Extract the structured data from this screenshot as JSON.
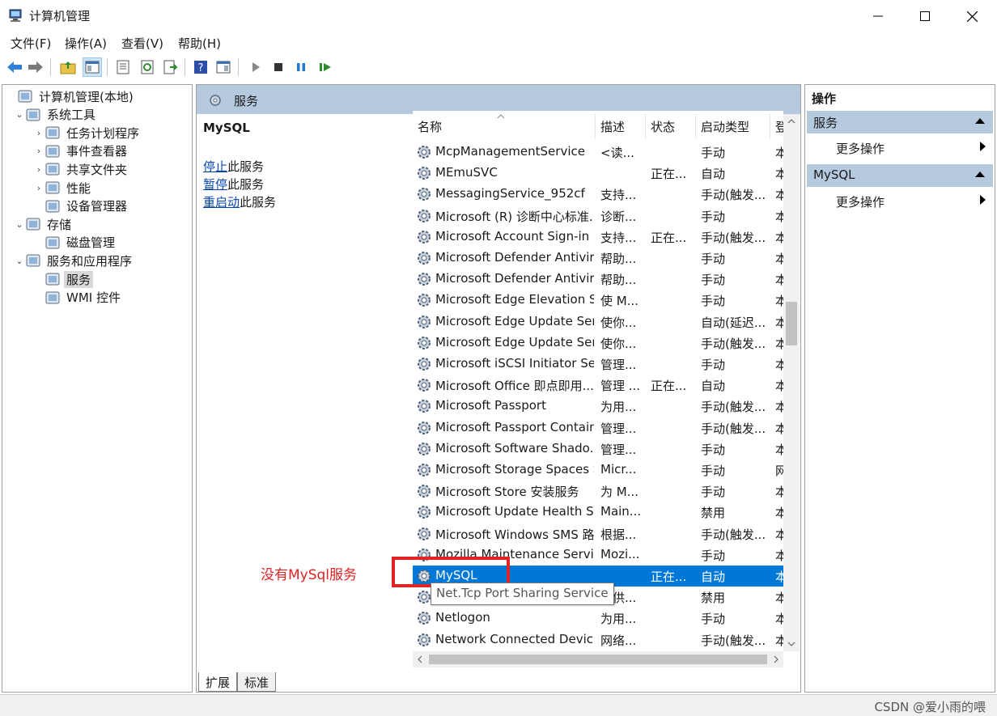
{
  "window": {
    "title": "计算机管理"
  },
  "menu": [
    "文件(F)",
    "操作(A)",
    "查看(V)",
    "帮助(H)"
  ],
  "tree": [
    {
      "label": "计算机管理(本地)",
      "level": 0,
      "arrow": "",
      "icon": "computer-mgmt-icon"
    },
    {
      "label": "系统工具",
      "level": 1,
      "arrow": "⌄",
      "icon": "tools-icon"
    },
    {
      "label": "任务计划程序",
      "level": 2,
      "arrow": "›",
      "icon": "clock-icon"
    },
    {
      "label": "事件查看器",
      "level": 2,
      "arrow": "›",
      "icon": "event-viewer-icon"
    },
    {
      "label": "共享文件夹",
      "level": 2,
      "arrow": "›",
      "icon": "shared-folder-icon"
    },
    {
      "label": "性能",
      "level": 2,
      "arrow": "›",
      "icon": "performance-icon"
    },
    {
      "label": "设备管理器",
      "level": 2,
      "arrow": "",
      "icon": "device-manager-icon"
    },
    {
      "label": "存储",
      "level": 1,
      "arrow": "⌄",
      "icon": "storage-icon"
    },
    {
      "label": "磁盘管理",
      "level": 2,
      "arrow": "",
      "icon": "disk-icon"
    },
    {
      "label": "服务和应用程序",
      "level": 1,
      "arrow": "⌄",
      "icon": "apps-icon"
    },
    {
      "label": "服务",
      "level": 2,
      "arrow": "",
      "icon": "services-icon",
      "selected": true
    },
    {
      "label": "WMI 控件",
      "level": 2,
      "arrow": "",
      "icon": "wmi-icon"
    }
  ],
  "center": {
    "header": "服务",
    "selected_name": "MySQL",
    "actions": [
      {
        "link": "停止",
        "suffix": "此服务"
      },
      {
        "link": "暂停",
        "suffix": "此服务"
      },
      {
        "link": "重启动",
        "suffix": "此服务"
      }
    ],
    "columns": [
      "名称",
      "描述",
      "状态",
      "启动类型",
      "登"
    ],
    "rows": [
      [
        "McpManagementService",
        "<读...",
        "",
        "手动",
        "本"
      ],
      [
        "MEmuSVC",
        "",
        "正在...",
        "自动",
        "本"
      ],
      [
        "MessagingService_952cf",
        "支持...",
        "",
        "手动(触发...",
        "本"
      ],
      [
        "Microsoft (R) 诊断中心标准...",
        "诊断...",
        "",
        "手动",
        "本"
      ],
      [
        "Microsoft Account Sign-in ...",
        "支持...",
        "正在...",
        "手动(触发...",
        "本"
      ],
      [
        "Microsoft Defender Antivir...",
        "帮助...",
        "",
        "手动",
        "本"
      ],
      [
        "Microsoft Defender Antivir...",
        "帮助...",
        "",
        "手动",
        "本"
      ],
      [
        "Microsoft Edge Elevation S...",
        "使 M...",
        "",
        "手动",
        "本"
      ],
      [
        "Microsoft Edge Update Ser...",
        "使你...",
        "",
        "自动(延迟...",
        "本"
      ],
      [
        "Microsoft Edge Update Ser...",
        "使你...",
        "",
        "手动(触发...",
        "本"
      ],
      [
        "Microsoft iSCSI Initiator Ser...",
        "管理...",
        "",
        "手动",
        "本"
      ],
      [
        "Microsoft Office 即点即用...",
        "管理 ...",
        "正在...",
        "自动",
        "本"
      ],
      [
        "Microsoft Passport",
        "为用...",
        "",
        "手动(触发...",
        "本"
      ],
      [
        "Microsoft Passport Container",
        "管理...",
        "",
        "手动(触发...",
        "本"
      ],
      [
        "Microsoft Software Shado...",
        "管理...",
        "",
        "手动",
        "本"
      ],
      [
        "Microsoft Storage Spaces S...",
        "Micr...",
        "",
        "手动",
        "网"
      ],
      [
        "Microsoft Store 安装服务",
        "为 M...",
        "",
        "手动",
        "本"
      ],
      [
        "Microsoft Update Health S...",
        "Main...",
        "",
        "禁用",
        "本"
      ],
      [
        "Microsoft Windows SMS 路...",
        "根据...",
        "",
        "手动(触发...",
        "本"
      ],
      [
        "Mozilla Maintenance Service",
        "Mozi...",
        "",
        "手动",
        "本"
      ],
      [
        "MySQL",
        "",
        "正在...",
        "自动",
        "本"
      ],
      [
        "Net.Tcp Port Sharing Service",
        "提供...",
        "",
        "禁用",
        "本"
      ],
      [
        "Netlogon",
        "为用...",
        "",
        "手动",
        "本"
      ],
      [
        "Network Connected Devic...",
        "网络...",
        "",
        "手动(触发...",
        "本"
      ]
    ],
    "selected_row": 20,
    "tooltip": "Net.Tcp Port Sharing Service",
    "tabs": [
      "扩展",
      "标准"
    ]
  },
  "actions_panel": {
    "title": "操作",
    "sections": [
      {
        "name": "服务",
        "item": "更多操作"
      },
      {
        "name": "MySQL",
        "item": "更多操作"
      }
    ]
  },
  "annotation": "没有MySql服务",
  "watermark": "CSDN @爱小雨的喂",
  "colors": {
    "selection": "#0078d7",
    "header": "#b5c9df",
    "annotation": "#e02424"
  }
}
